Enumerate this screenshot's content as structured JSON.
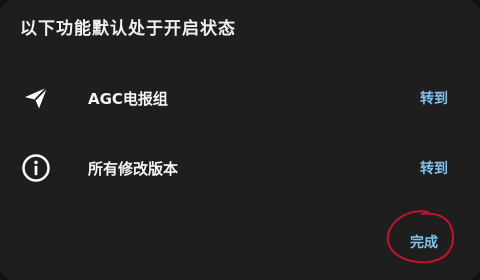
{
  "dialog": {
    "title": "以下功能默认处于开启状态",
    "rows": [
      {
        "icon": "send-icon",
        "label": "AGC电报组",
        "action": "转到"
      },
      {
        "icon": "info-icon",
        "label": "所有修改版本",
        "action": "转到"
      }
    ],
    "done_label": "完成"
  },
  "colors": {
    "background": "#1e1e1e",
    "accent": "#7ec3ee",
    "annotation": "#c8102e"
  }
}
